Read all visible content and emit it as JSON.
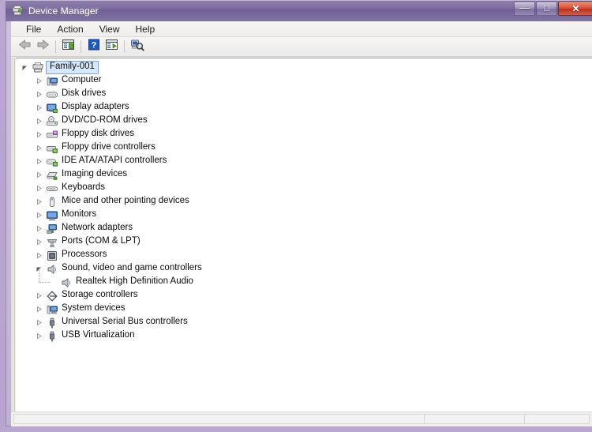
{
  "window": {
    "title": "Device Manager",
    "title_icon": "device-manager-icon",
    "controls": {
      "minimize": "—",
      "maximize": "□",
      "close": "✕"
    }
  },
  "menubar": {
    "items": [
      {
        "label": "File",
        "name": "menu-file"
      },
      {
        "label": "Action",
        "name": "menu-action"
      },
      {
        "label": "View",
        "name": "menu-view"
      },
      {
        "label": "Help",
        "name": "menu-help"
      }
    ]
  },
  "toolbar": {
    "buttons": [
      {
        "name": "back-button",
        "icon": "back-arrow-icon"
      },
      {
        "name": "forward-button",
        "icon": "forward-arrow-icon"
      },
      {
        "name": "show-hidden-devices-button",
        "icon": "console-tree-icon"
      },
      {
        "name": "help-button",
        "icon": "question-mark-icon"
      },
      {
        "name": "properties-button",
        "icon": "properties-icon"
      },
      {
        "name": "scan-hardware-changes-button",
        "icon": "scan-hardware-icon"
      }
    ]
  },
  "tree": {
    "root": {
      "label": "Family-001",
      "icon": "computer-root-icon",
      "selected": true,
      "expanded": true
    },
    "nodes": [
      {
        "label": "Computer",
        "icon": "computer-icon",
        "expanded": false,
        "depth": 1
      },
      {
        "label": "Disk drives",
        "icon": "disk-drive-icon",
        "expanded": false,
        "depth": 1
      },
      {
        "label": "Display adapters",
        "icon": "display-adapter-icon",
        "expanded": false,
        "depth": 1
      },
      {
        "label": "DVD/CD-ROM drives",
        "icon": "dvd-drive-icon",
        "expanded": false,
        "depth": 1
      },
      {
        "label": "Floppy disk drives",
        "icon": "floppy-disk-icon",
        "expanded": false,
        "depth": 1
      },
      {
        "label": "Floppy drive controllers",
        "icon": "floppy-controller-icon",
        "expanded": false,
        "depth": 1
      },
      {
        "label": "IDE ATA/ATAPI controllers",
        "icon": "ide-controller-icon",
        "expanded": false,
        "depth": 1
      },
      {
        "label": "Imaging devices",
        "icon": "imaging-device-icon",
        "expanded": false,
        "depth": 1
      },
      {
        "label": "Keyboards",
        "icon": "keyboard-icon",
        "expanded": false,
        "depth": 1
      },
      {
        "label": "Mice and other pointing devices",
        "icon": "mouse-icon",
        "expanded": false,
        "depth": 1
      },
      {
        "label": "Monitors",
        "icon": "monitor-icon",
        "expanded": false,
        "depth": 1
      },
      {
        "label": "Network adapters",
        "icon": "network-adapter-icon",
        "expanded": false,
        "depth": 1
      },
      {
        "label": "Ports (COM & LPT)",
        "icon": "port-icon",
        "expanded": false,
        "depth": 1
      },
      {
        "label": "Processors",
        "icon": "processor-icon",
        "expanded": false,
        "depth": 1
      },
      {
        "label": "Sound, video and game controllers",
        "icon": "speaker-icon",
        "expanded": true,
        "depth": 1
      },
      {
        "label": "Realtek High Definition Audio",
        "icon": "speaker-icon",
        "expanded": null,
        "depth": 2
      },
      {
        "label": "Storage controllers",
        "icon": "storage-controller-icon",
        "expanded": false,
        "depth": 1
      },
      {
        "label": "System devices",
        "icon": "system-device-icon",
        "expanded": false,
        "depth": 1
      },
      {
        "label": "Universal Serial Bus controllers",
        "icon": "usb-icon",
        "expanded": false,
        "depth": 1
      },
      {
        "label": "USB Virtualization",
        "icon": "usb-icon",
        "expanded": false,
        "depth": 1
      }
    ]
  },
  "statusbar": {
    "segments": [
      "",
      "",
      ""
    ]
  },
  "colors": {
    "selection_fill": "#d6e8fb",
    "selection_border": "#7da2ce",
    "title_gradient_top": "#8f7fae",
    "close_button": "#d7503a",
    "tree_background": "#ffffff"
  }
}
